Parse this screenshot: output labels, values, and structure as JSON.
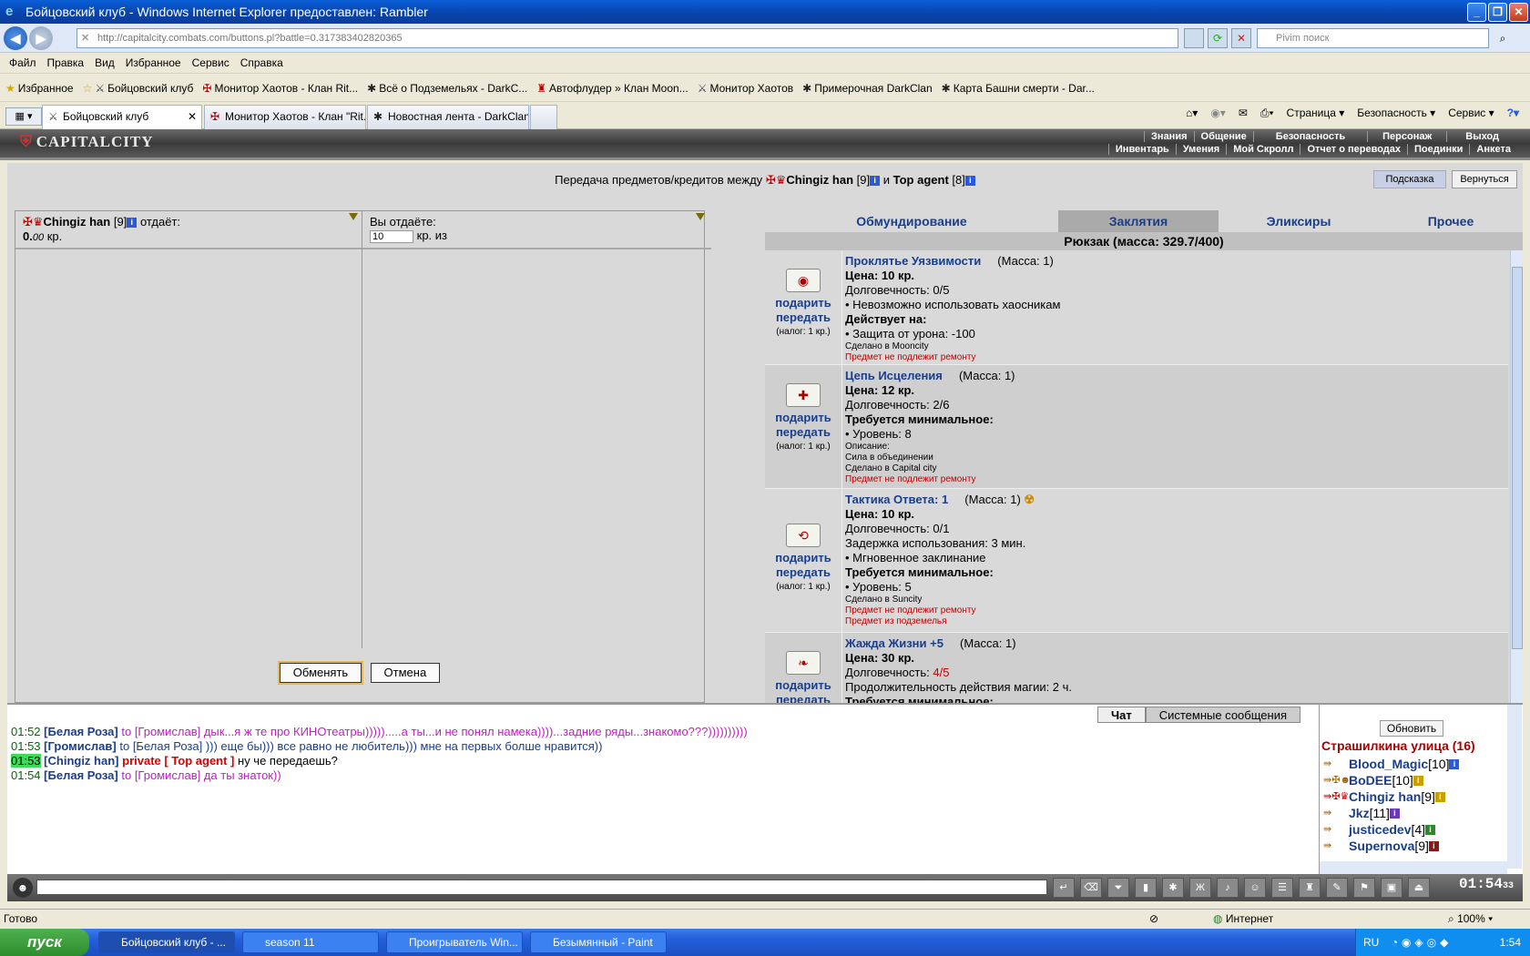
{
  "window": {
    "title": "Бойцовский клуб - Windows Internet Explorer предоставлен: Rambler"
  },
  "browser": {
    "url": "http://capitalcity.combats.com/buttons.pl?battle=0.317383402820365",
    "search_placeholder": "Pivim поиск",
    "menu": [
      "Файл",
      "Правка",
      "Вид",
      "Избранное",
      "Сервис",
      "Справка"
    ],
    "favorites_label": "Избранное",
    "favorites": [
      "Бойцовский клуб",
      "Монитор Хаотов - Клан Rit...",
      "Всё о Подземельях - DarkC...",
      "Автофлудер » Клан Moon...",
      "Монитор Хаотов",
      "Примерочная DarkClan",
      "Карта Башни смерти - Dar..."
    ],
    "tabs": [
      "Бойцовский клуб",
      "Монитор Хаотов - Клан \"Rit...",
      "Новостная лента - DarkClan"
    ],
    "tools": [
      "Страница",
      "Безопасность",
      "Сервис"
    ]
  },
  "game_header": {
    "logo": "CAPITALCITY",
    "menu_top": [
      "Знания",
      "Общение",
      "Безопасность",
      "Персонаж",
      "Выход"
    ],
    "menu_bottom": [
      "Инвентарь",
      "Умения",
      "Мой Скролл",
      "Отчет о переводах",
      "Поединки",
      "Анкета"
    ]
  },
  "transfer": {
    "title_prefix": "Передача предметов/кредитов между",
    "user1": "Chingiz han",
    "user1_level": "[9]",
    "conj": "и",
    "user2": "Top agent",
    "user2_level": "[8]",
    "hint_button": "Подсказка",
    "back_button": "Вернуться",
    "left_col": {
      "name": "Chingiz han",
      "level": "[9]",
      "gives": "отдаёт:",
      "amount_int": "0.",
      "amount_dec": "00",
      "currency": "кр."
    },
    "right_col": {
      "label": "Вы отдаёте:",
      "amount": "10",
      "suffix": "кр. из"
    },
    "exchange_button": "Обменять",
    "cancel_button": "Отмена"
  },
  "inventory": {
    "tabs": [
      "Обмундирование",
      "Заклятия",
      "Эликсиры",
      "Прочее"
    ],
    "selected_tab": "Заклятия",
    "backpack": "Рюкзак (масса: 329.7/400)",
    "items": [
      {
        "name": "Проклятье Уязвимости",
        "mass": "(Масса: 1)",
        "price": "Цена: 10 кр.",
        "lines": [
          "Долговечность: 0/5",
          "• Невозможно использовать хаосникам"
        ],
        "bold": "Действует на:",
        "lines2": [
          "• Защита от урона: -100"
        ],
        "small": [
          "Сделано в Mooncity"
        ],
        "red": [
          "Предмет не подлежит ремонту"
        ]
      },
      {
        "name": "Цепь Исцеления",
        "mass": "(Масса: 1)",
        "price": "Цена: 12 кр.",
        "lines": [
          "Долговечность: 2/6"
        ],
        "bold": "Требуется минимальное:",
        "lines2": [
          "• Уровень: 8"
        ],
        "small": [
          "Описание:",
          "Сила в объединении",
          "Сделано в Capital city"
        ],
        "red": [
          "Предмет не подлежит ремонту"
        ]
      },
      {
        "name": "Тактика Ответа: 1",
        "mass": "(Масса: 1)",
        "price": "Цена: 10 кр.",
        "lines": [
          "Долговечность: 0/1",
          "Задержка использования: 3 мин.",
          "• Мгновенное заклинание"
        ],
        "bold": "Требуется минимальное:",
        "lines2": [
          "• Уровень: 5"
        ],
        "small": [
          "Сделано в Suncity"
        ],
        "red": [
          "Предмет не подлежит ремонту",
          "Предмет из подземелья"
        ]
      },
      {
        "name": "Жажда Жизни +5",
        "mass": "(Масса: 1)",
        "price": "Цена: 30 кр.",
        "lines": [
          "Долговечность: 4/5",
          "Продолжительность действия магии: 2 ч."
        ],
        "bold": "Требуется минимальное:",
        "lines2": [],
        "small": [],
        "red": []
      }
    ],
    "action_give": "подарить",
    "action_transfer": "передать",
    "tax": "(налог: 1 кр.)"
  },
  "chat": {
    "tabs": [
      "Чат",
      "Системные сообщения"
    ],
    "lines": [
      {
        "time": "01:52",
        "nick": "[Белая Роза]",
        "text": "to [Громислав] дык...я ж те про КИНОтеатры))))).....а ты...и не понял намека))))...задние ряды...знакомо???))))))))))",
        "style": "to"
      },
      {
        "time": "01:53",
        "nick": "[Громислав]",
        "text": "to [Белая Роза] ))) еще бы))) все равно не любитель))) мне на первых болше нравится))",
        "style": "plain"
      },
      {
        "time": "01:53",
        "nick": "[Chingiz han]",
        "private": "private [ Top agent ]",
        "text": "ну че передаешь?",
        "style": "private"
      },
      {
        "time": "01:54",
        "nick": "[Белая Роза]",
        "text": "to [Громислав] да ты знаток))",
        "style": "to"
      }
    ]
  },
  "online": {
    "refresh": "Обновить",
    "street": "Страшилкина улица (16)",
    "users": [
      {
        "name": "Blood_Magic",
        "level": "[10]"
      },
      {
        "name": "BoDEE",
        "level": "[10]"
      },
      {
        "name": "Chingiz han",
        "level": "[9]"
      },
      {
        "name": "Jkz",
        "level": "[11]"
      },
      {
        "name": "justicedev",
        "level": "[4]"
      },
      {
        "name": "Supernova",
        "level": "[9]"
      }
    ]
  },
  "gamebar": {
    "clock": "01:54",
    "clock_sec": "33"
  },
  "status": {
    "left": "Готово",
    "zone": "Интернет",
    "zoom": "100%"
  },
  "taskbar": {
    "start": "пуск",
    "tasks": [
      "Бойцовский клуб - ...",
      "season 11",
      "Проигрыватель Win...",
      "Безымянный - Paint"
    ],
    "lang": "RU",
    "time": "1:54"
  },
  "colors": {
    "accent_blue": "#1a3f8a",
    "chat_pink": "#c020c0",
    "street_red": "#a00000"
  }
}
